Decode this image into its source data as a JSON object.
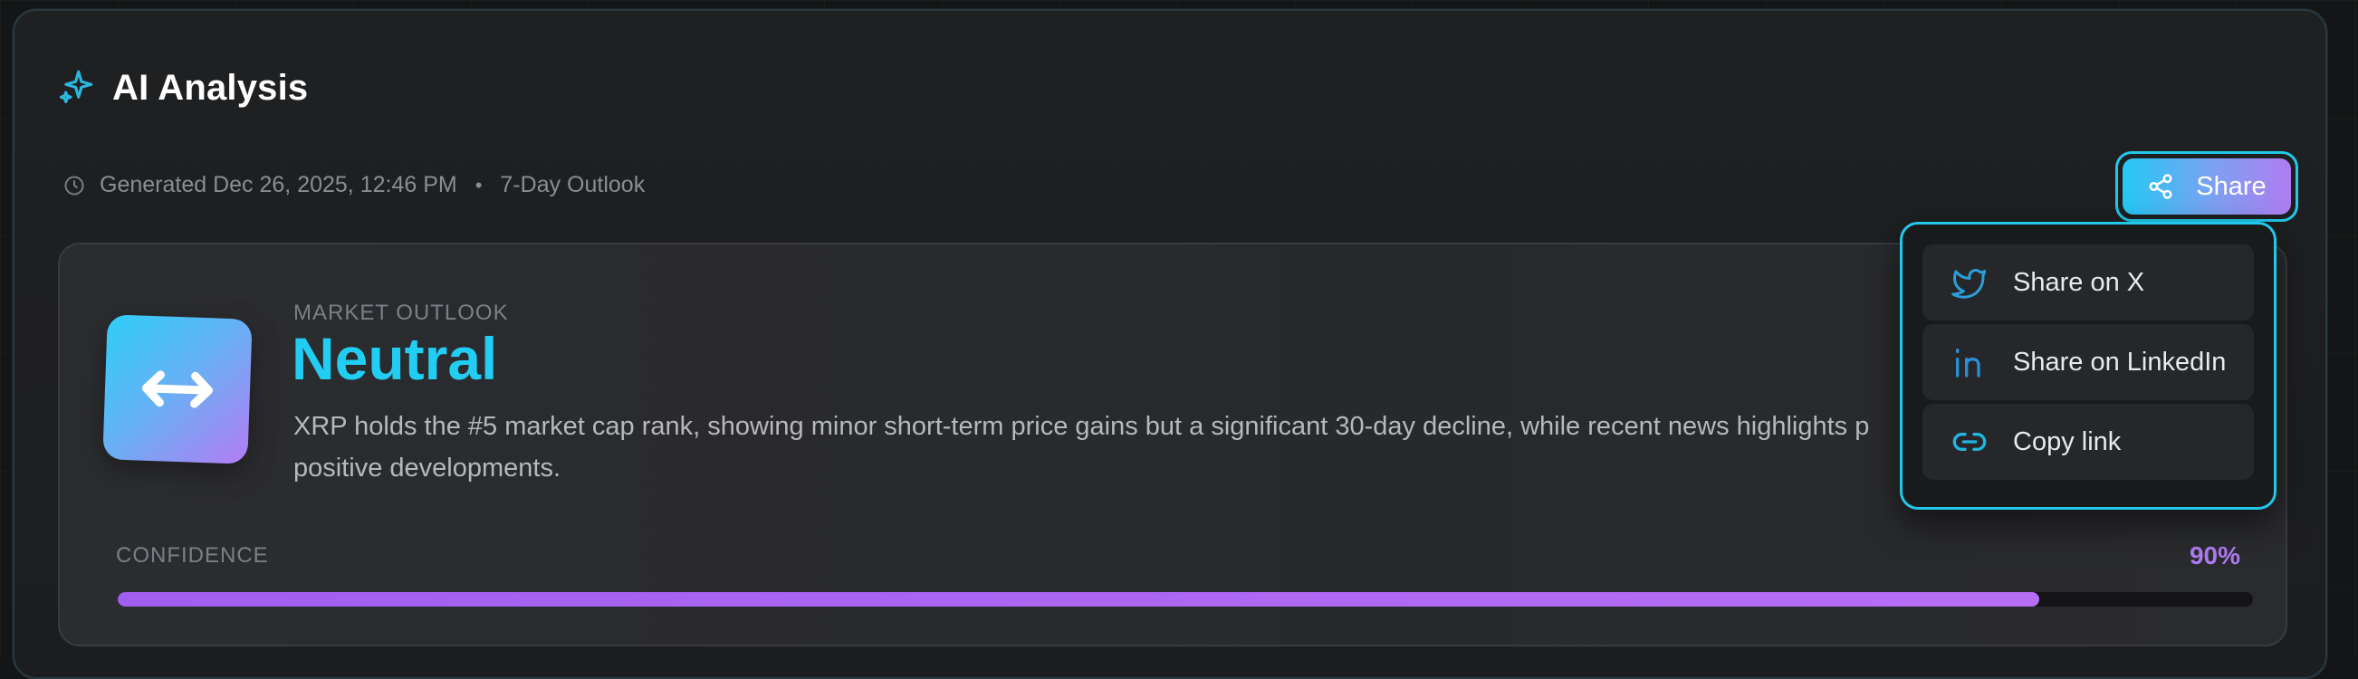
{
  "header": {
    "title": "AI Analysis",
    "icon": "sparkle-icon"
  },
  "meta": {
    "generated": "Generated Dec 26, 2025, 12:46 PM",
    "separator": "•",
    "horizon": "7-Day Outlook"
  },
  "share": {
    "label": "Share",
    "icon": "share-icon"
  },
  "share_menu": {
    "items": [
      {
        "label": "Share on X",
        "icon": "twitter-icon"
      },
      {
        "label": "Share on LinkedIn",
        "icon": "linkedin-icon"
      },
      {
        "label": "Copy link",
        "icon": "link-icon"
      }
    ]
  },
  "outlook": {
    "label": "MARKET OUTLOOK",
    "sentiment": "Neutral",
    "icon": "arrows-left-right-icon",
    "summary_line1": "XRP holds the #5 market cap rank, showing minor short-term price gains but a significant 30-day decline, while recent news highlights p",
    "summary_line2": "positive developments."
  },
  "confidence": {
    "label": "CONFIDENCE",
    "value_text": "90%",
    "fraction": 0.9
  },
  "colors": {
    "accent_cyan": "#22cdf4",
    "accent_purple": "#b07cf2"
  }
}
